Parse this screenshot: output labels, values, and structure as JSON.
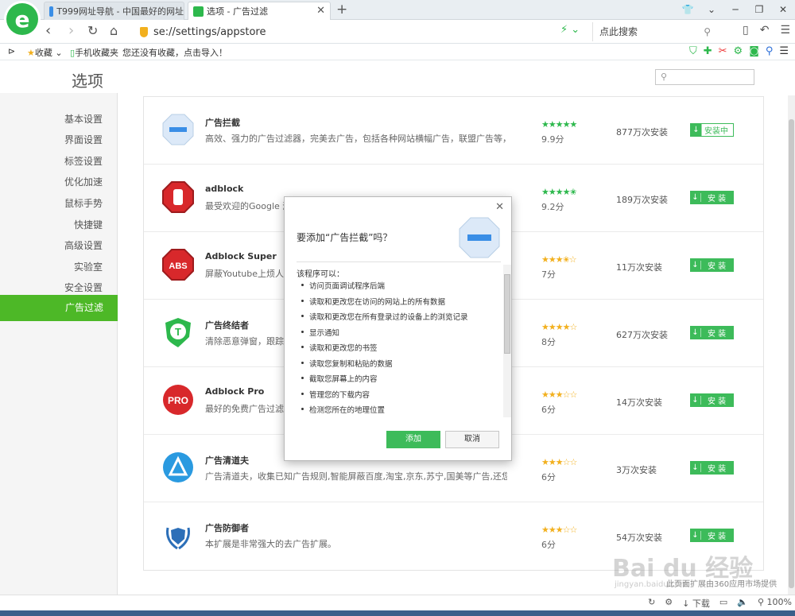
{
  "browser": {
    "tabs": [
      {
        "label": "T999网址导航 - 中国最好的网址"
      },
      {
        "label": "选项 - 广告过滤"
      }
    ],
    "address": "se://settings/appstore",
    "search_placeholder": "点此搜索",
    "favorites": {
      "fav_label": "收藏",
      "mobile_label": "手机收藏夹",
      "empty_text": "您还没有收藏，点击导入！"
    }
  },
  "page": {
    "title": "选项",
    "sidebar": [
      "基本设置",
      "界面设置",
      "标签设置",
      "优化加速",
      "鼠标手势",
      "快捷键",
      "高级设置",
      "实验室",
      "安全设置"
    ],
    "sidebar_active": "广告过滤",
    "extensions": [
      {
        "name": "广告拦截",
        "desc": "高效、强力的广告过滤器，完美去广告，包括各种网站横幅广告，联盟广告等，...",
        "stars": 5,
        "score": "9.9分",
        "installs": "877万次安装",
        "button": "安装中",
        "state": "installing"
      },
      {
        "name": "adblock",
        "desc": "最受欢迎的Google 浏",
        "stars": 4.5,
        "score": "9.2分",
        "installs": "189万次安装",
        "button": "安 装",
        "state": "install"
      },
      {
        "name": "Adblock Super",
        "desc": "屏蔽Youtube上烦人的",
        "stars": 3.5,
        "score": "7分",
        "installs": "11万次安装",
        "button": "安 装",
        "state": "install"
      },
      {
        "name": "广告终结者",
        "desc": "清除恶意弹窗，跟踪代",
        "stars": 4,
        "score": "8分",
        "installs": "627万次安装",
        "button": "安 装",
        "state": "install"
      },
      {
        "name": "Adblock Pro",
        "desc": "最好的免费广告过滤工",
        "stars": 3,
        "score": "6分",
        "installs": "14万次安装",
        "button": "安 装",
        "state": "install"
      },
      {
        "name": "广告清道夫",
        "desc": "广告清道夫，收集已知广告规则,智能屏蔽百度,淘宝,京东,苏宁,国美等广告,还您...",
        "stars": 3,
        "score": "6分",
        "installs": "3万次安装",
        "button": "安 装",
        "state": "install"
      },
      {
        "name": "广告防御者",
        "desc": "本扩展是非常强大的去广告扩展。",
        "stars": 3,
        "score": "6分",
        "installs": "54万次安装",
        "button": "安 装",
        "state": "install"
      }
    ],
    "footnote": "此页面扩展由360应用市场提供"
  },
  "dialog": {
    "title": "要添加“广告拦截”吗？",
    "subtitle": "该程序可以：",
    "permissions": [
      "访问页面调试程序后端",
      "读取和更改您在访问的网站上的所有数据",
      "读取和更改您在所有登录过的设备上的浏览记录",
      "显示通知",
      "读取和更改您的书签",
      "读取您复制和粘贴的数据",
      "截取您屏幕上的内容",
      "管理您的下载内容",
      "检测您所在的地理位置"
    ],
    "add_label": "添加",
    "cancel_label": "取消"
  },
  "status": {
    "download": "下载",
    "zoom": "100%"
  },
  "colors": {
    "accent_green": "#4db827",
    "button_green": "#3dbb5a",
    "star_green": "#2db84c",
    "star_yellow": "#f2b01e"
  }
}
